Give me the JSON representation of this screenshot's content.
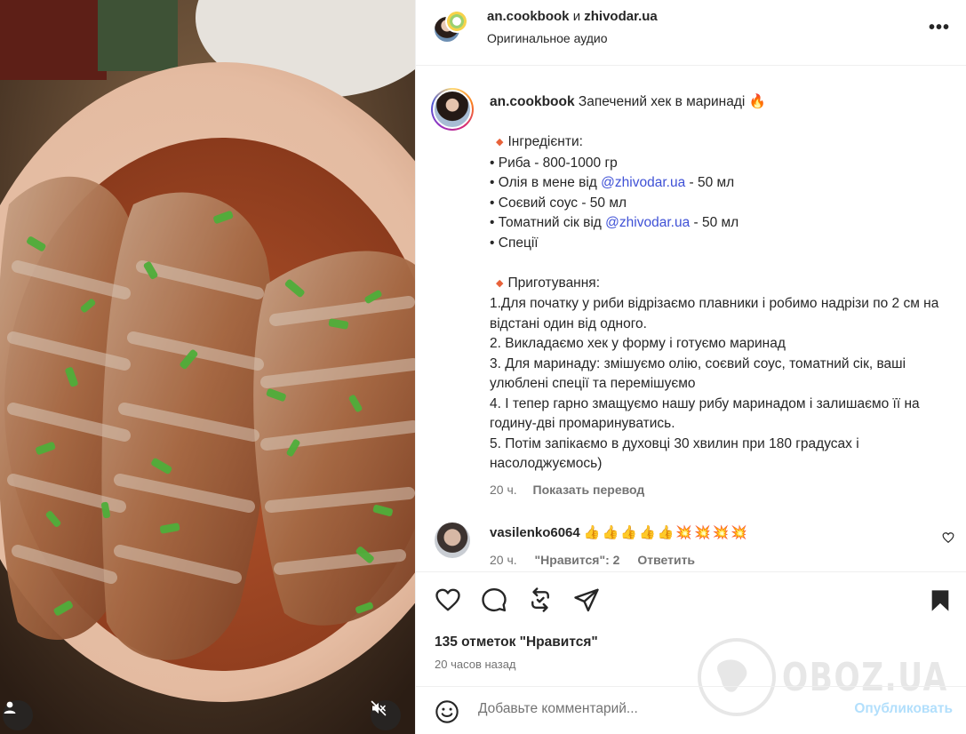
{
  "header": {
    "user1": "an.cookbook",
    "and": "и",
    "user2": "zhivodar.ua",
    "audio": "Оригинальное аудио",
    "more": "•••"
  },
  "caption": {
    "username": "an.cookbook",
    "title": "Запечений хек в маринаді",
    "title_emoji": "🔥",
    "ingredients_heading": "Інгредієнти:",
    "bullet": "•",
    "ing1": "Риба - 800-1000 гр",
    "ing2_pre": "Олія в мене від",
    "ing2_mention": "@zhivodar.ua",
    "ing2_post": "- 50 мл",
    "ing3": "Соєвий соус - 50 мл",
    "ing4_pre": "Томатний сік від",
    "ing4_mention": "@zhivodar.ua",
    "ing4_post": "- 50 мл",
    "ing5": "Спеції",
    "prep_heading": "Приготування:",
    "step1": "1.Для початку у риби відрізаємо плавники і робимо надрізи по 2 см на відстані один від одного.",
    "step2": "2. Викладаємо хек у форму і готуємо маринад",
    "step3": "3. Для маринаду: змішуємо олію, соєвий соус, томатний сік, ваші улюблені спеції та перемішуємо",
    "step4": "4. І тепер гарно змащуємо нашу рибу маринадом і залишаємо її на годину-дві промаринуватись.",
    "step5": "5. Потім запікаємо в духовці 30 хвилин при 180 градусах і насолоджуємось)",
    "time": "20 ч.",
    "translate": "Показать перевод"
  },
  "comment": {
    "username": "vasilenko6064",
    "emojis": "👍👍👍👍👍💥💥💥💥",
    "time": "20 ч.",
    "likes": "\"Нравится\": 2",
    "reply": "Ответить"
  },
  "actions": {
    "likes_count": "135 отметок \"Нравится\"",
    "posted": "20 часов назад"
  },
  "add_comment": {
    "placeholder": "Добавьте комментарий...",
    "post": "Опубликовать"
  },
  "watermark": "OBOZ.UA",
  "colors": {
    "mention": "#3f51d6",
    "post_disabled": "#b2dffc",
    "muted": "#737373"
  }
}
